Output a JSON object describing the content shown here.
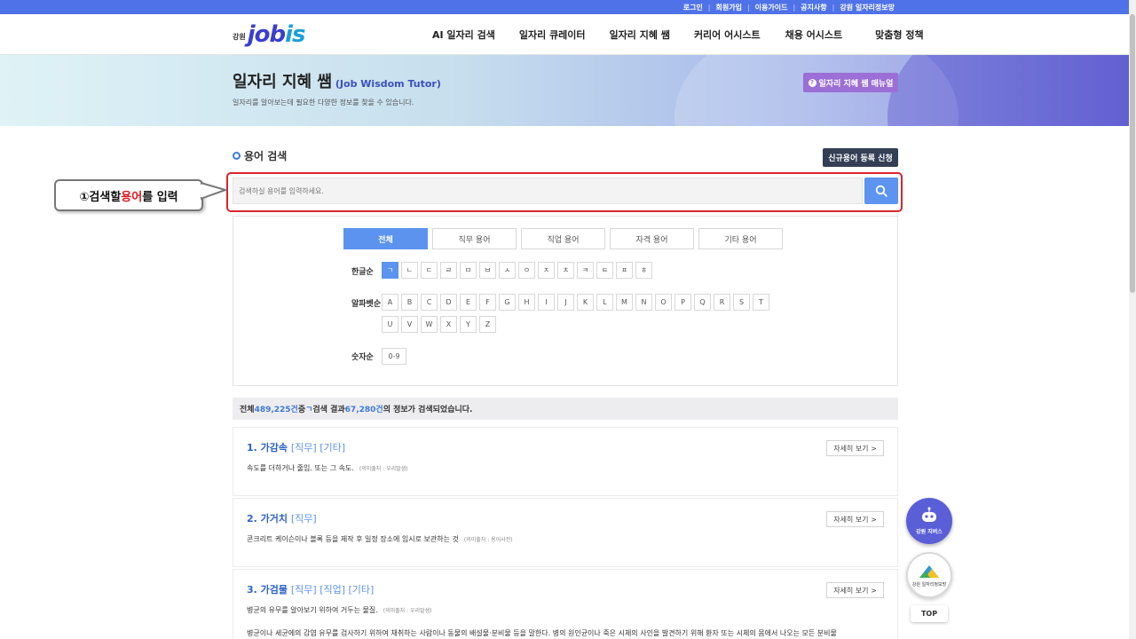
{
  "topbar": {
    "links": [
      "로그인",
      "회원가입",
      "이용가이드",
      "공지사항",
      "강원 일자리정보망"
    ]
  },
  "logo": {
    "region": "강원",
    "brand_a": "job",
    "brand_b": "is"
  },
  "gnb": [
    "AI 일자리 검색",
    "일자리 큐레이터",
    "일자리 지혜 쌤",
    "커리어 어시스트",
    "채용 어시스트",
    "맞춤형 정책"
  ],
  "hero": {
    "title": "일자리 지혜 쌤",
    "title_en": "(Job Wisdom Tutor)",
    "subtitle": "일자리를 알아보는데 필요한 다양한 정보를 찾을 수 있습니다.",
    "manual_button": "일자리 지혜 쌤 매뉴얼"
  },
  "search": {
    "section_title": "용어 검색",
    "new_term_button": "신규용어 등록 신청",
    "placeholder": "검색하실 용어를 입력하세요."
  },
  "callout": {
    "prefix": "①검색할 ",
    "highlight": "용어",
    "suffix": "를 입력"
  },
  "tabs": [
    "전체",
    "직무 용어",
    "직업 용어",
    "자격 용어",
    "기타 용어"
  ],
  "filters": {
    "hangul_label": "한글순",
    "hangul": [
      "ㄱ",
      "ㄴ",
      "ㄷ",
      "ㄹ",
      "ㅁ",
      "ㅂ",
      "ㅅ",
      "ㅇ",
      "ㅈ",
      "ㅊ",
      "ㅋ",
      "ㅌ",
      "ㅍ",
      "ㅎ"
    ],
    "alpha_label": "알파벳순",
    "alpha": [
      "A",
      "B",
      "C",
      "D",
      "E",
      "F",
      "G",
      "H",
      "I",
      "J",
      "K",
      "L",
      "M",
      "N",
      "O",
      "P",
      "Q",
      "R",
      "S",
      "T",
      "U",
      "V",
      "W",
      "X",
      "Y",
      "Z"
    ],
    "number_label": "숫자순",
    "number": [
      "0-9"
    ]
  },
  "result_summary": {
    "p1": "전체 ",
    "total": "489,225건",
    "p2": " 중 ",
    "letter": "ㄱ",
    "p3": " 검색 결과 ",
    "count": "67,280건",
    "p4": "의 정보가 검색되었습니다."
  },
  "results": [
    {
      "title": "1. 가감속",
      "tags": "[직무] [기타]",
      "desc": "속도를 더하거나 줄임. 또는 그 속도.",
      "source": "(의미출처 : 우리말샘)",
      "desc2": "",
      "detail": "자세히 보기 >"
    },
    {
      "title": "2. 가거치",
      "tags": "[직무]",
      "desc": "콘크리트 케이슨이나 블록 등을 제작 후 일정 장소에 임시로 보관하는 것",
      "source": "(의미출처 : 용어사전)",
      "desc2": "",
      "detail": "자세히 보기 >"
    },
    {
      "title": "3. 가검물",
      "tags": "[직무] [직업] [기타]",
      "desc": "병균의 유무를 알아보기 위하여 거두는 물질.",
      "source": "(의미출처 : 우리말샘)",
      "desc2": "병균이나 세균에의 감염 유무를 검사하기 위하여 채취하는 사람이나 동물의 배설물·분비물 등을 말한다. 병의 원인균이나 죽은 시체의 사인을 발견하기 위해 환자 또는 시체의 몸에서 나오는 모든 분비물",
      "detail": "자세히 보기 >"
    }
  ],
  "floating": {
    "chat_label": "강원 지버스",
    "badge_label": "강원 일자리정보망",
    "top": "TOP"
  }
}
